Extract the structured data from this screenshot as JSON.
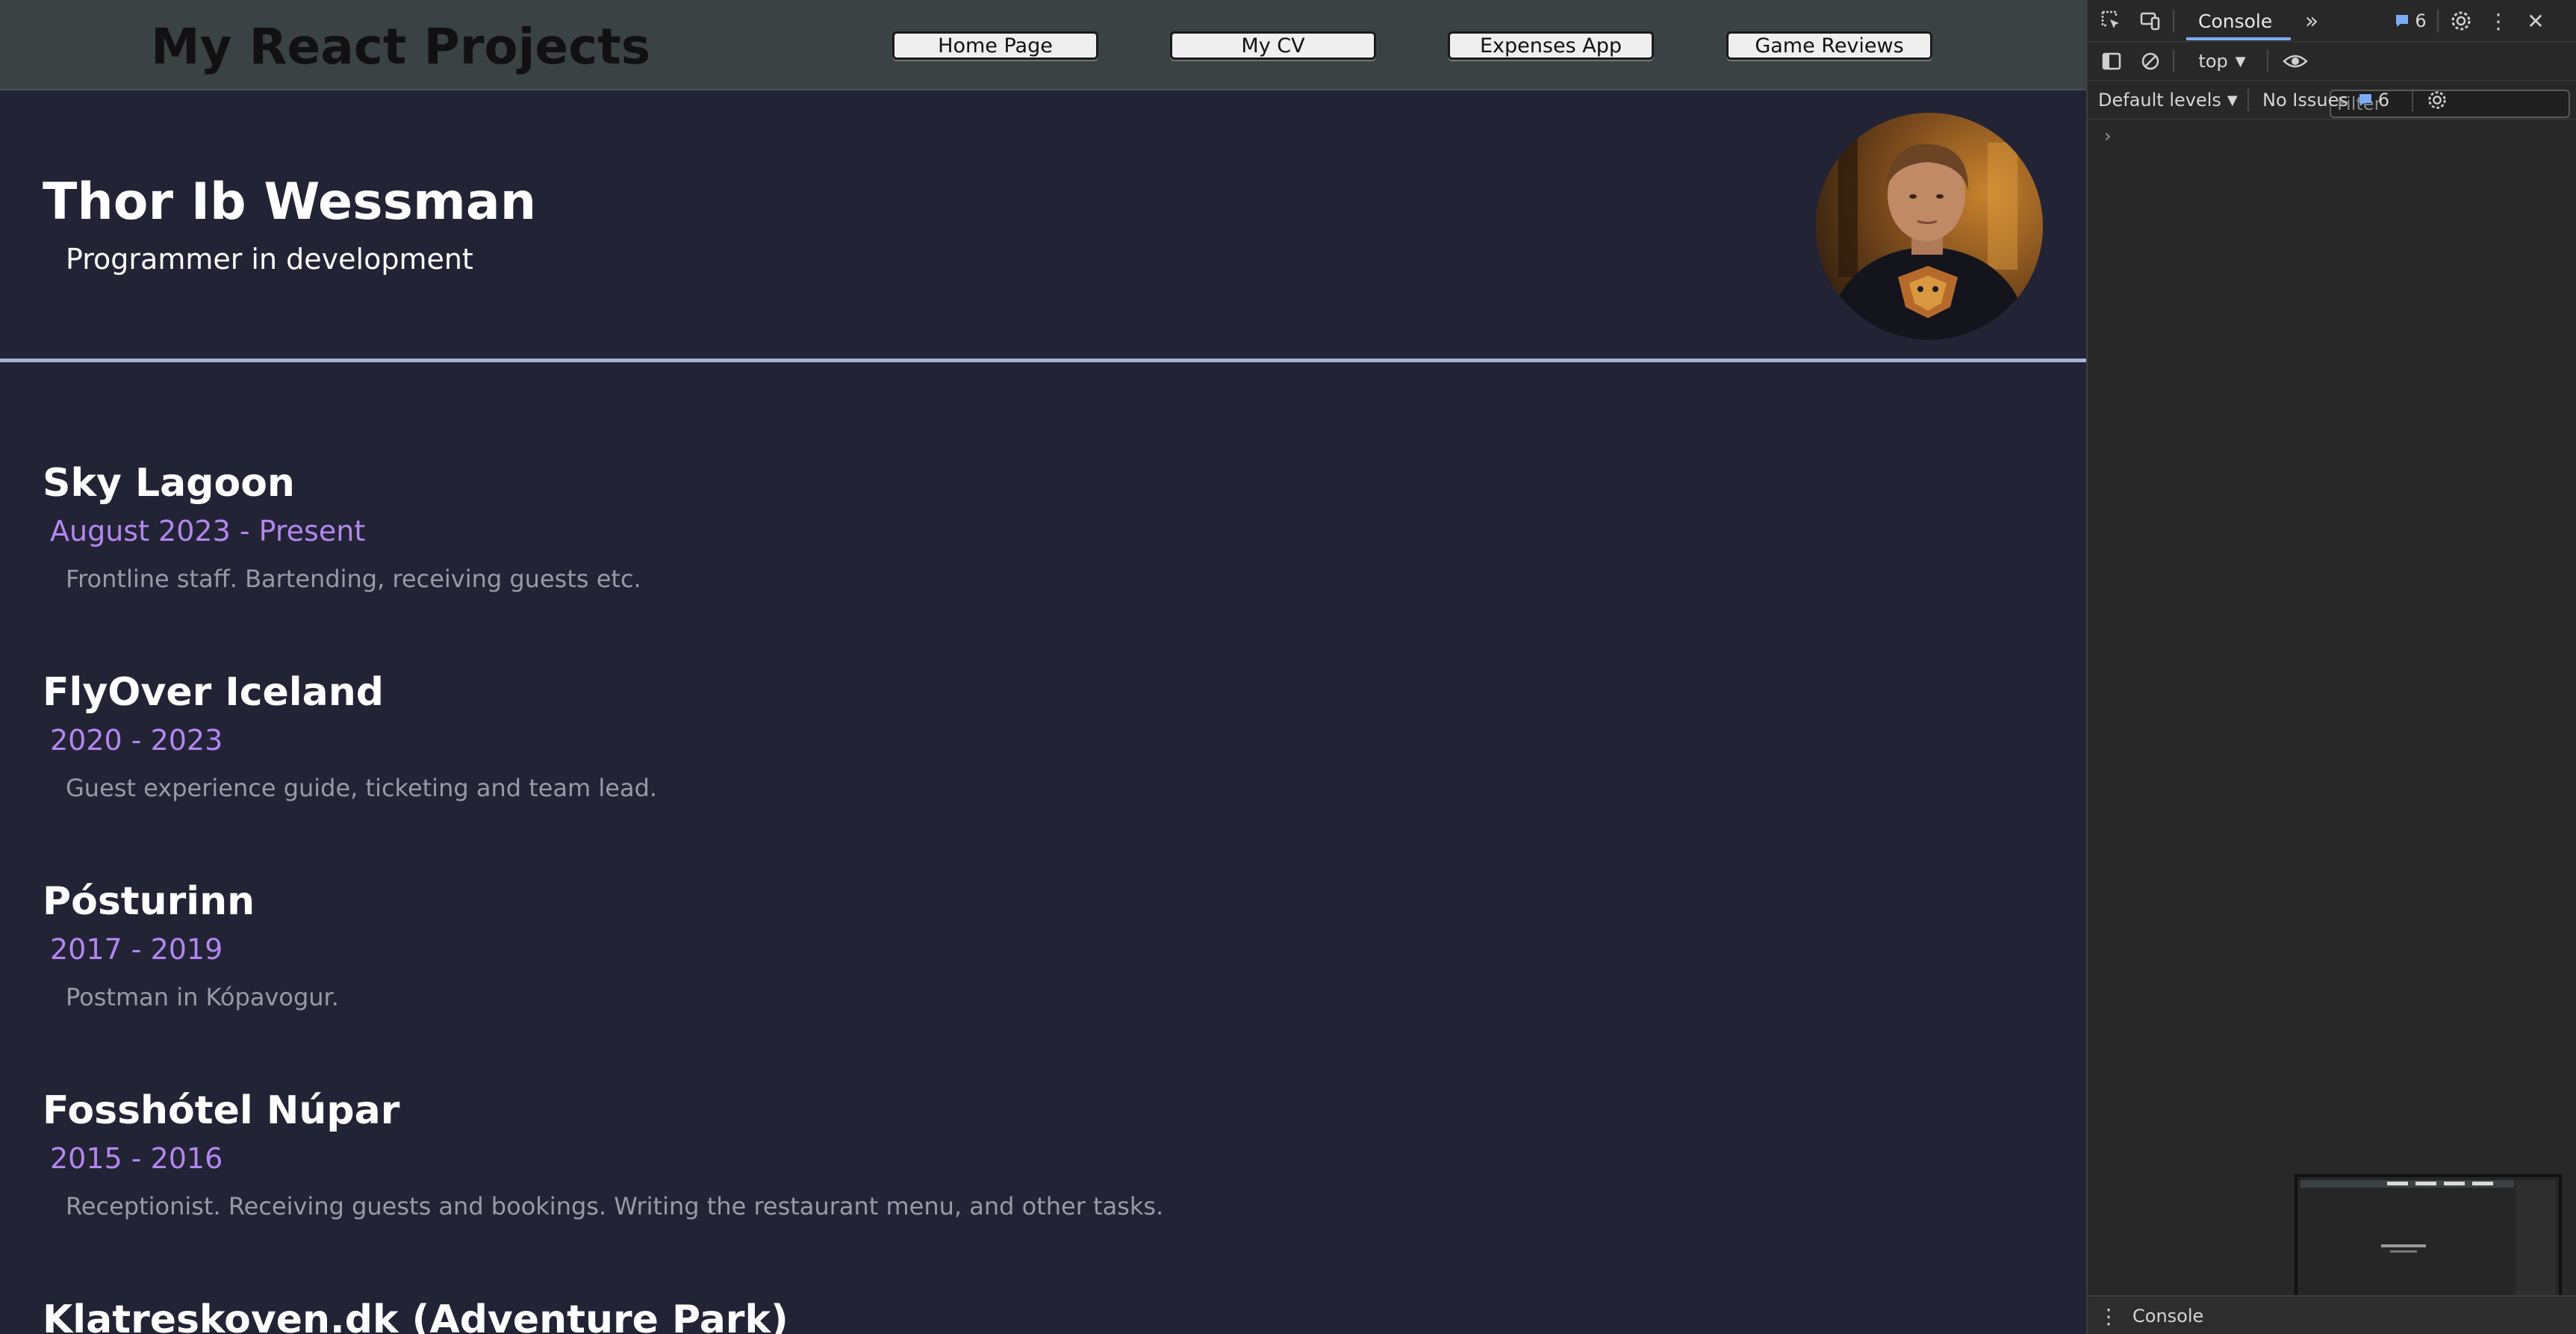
{
  "navbar": {
    "site_title": "My React Projects",
    "buttons": [
      "Home Page",
      "My CV",
      "Expenses App",
      "Game Reviews"
    ]
  },
  "profile": {
    "name": "Thor Ib Wessman",
    "title": "Programmer in development"
  },
  "jobs": [
    {
      "company": "Sky Lagoon",
      "period": "August 2023 - Present",
      "description": "Frontline staff. Bartending, receiving guests etc."
    },
    {
      "company": "FlyOver Iceland",
      "period": "2020 - 2023",
      "description": "Guest experience guide, ticketing and team lead."
    },
    {
      "company": "Pósturinn",
      "period": "2017 - 2019",
      "description": "Postman in Kópavogur."
    },
    {
      "company": "Fosshótel Núpar",
      "period": "2015 - 2016",
      "description": "Receptionist. Receiving guests and bookings. Writing the restaurant menu, and other tasks."
    },
    {
      "company": "Klatreskoven.dk (Adventure Park)",
      "period": "",
      "description": ""
    }
  ],
  "devtools": {
    "active_tab": "Console",
    "messages_count": "6",
    "context": "top",
    "filter_placeholder": "Filter",
    "levels": "Default levels",
    "issues_label": "No Issues",
    "issues_count": "6",
    "drawer_tab": "Console"
  },
  "colors": {
    "page_background": "#232336",
    "navbar_background": "#3b4243",
    "accent_date": "#b487f0",
    "divider": "#a7b2d8",
    "devtools_background": "#282828",
    "devtools_accent": "#7cacf8"
  }
}
